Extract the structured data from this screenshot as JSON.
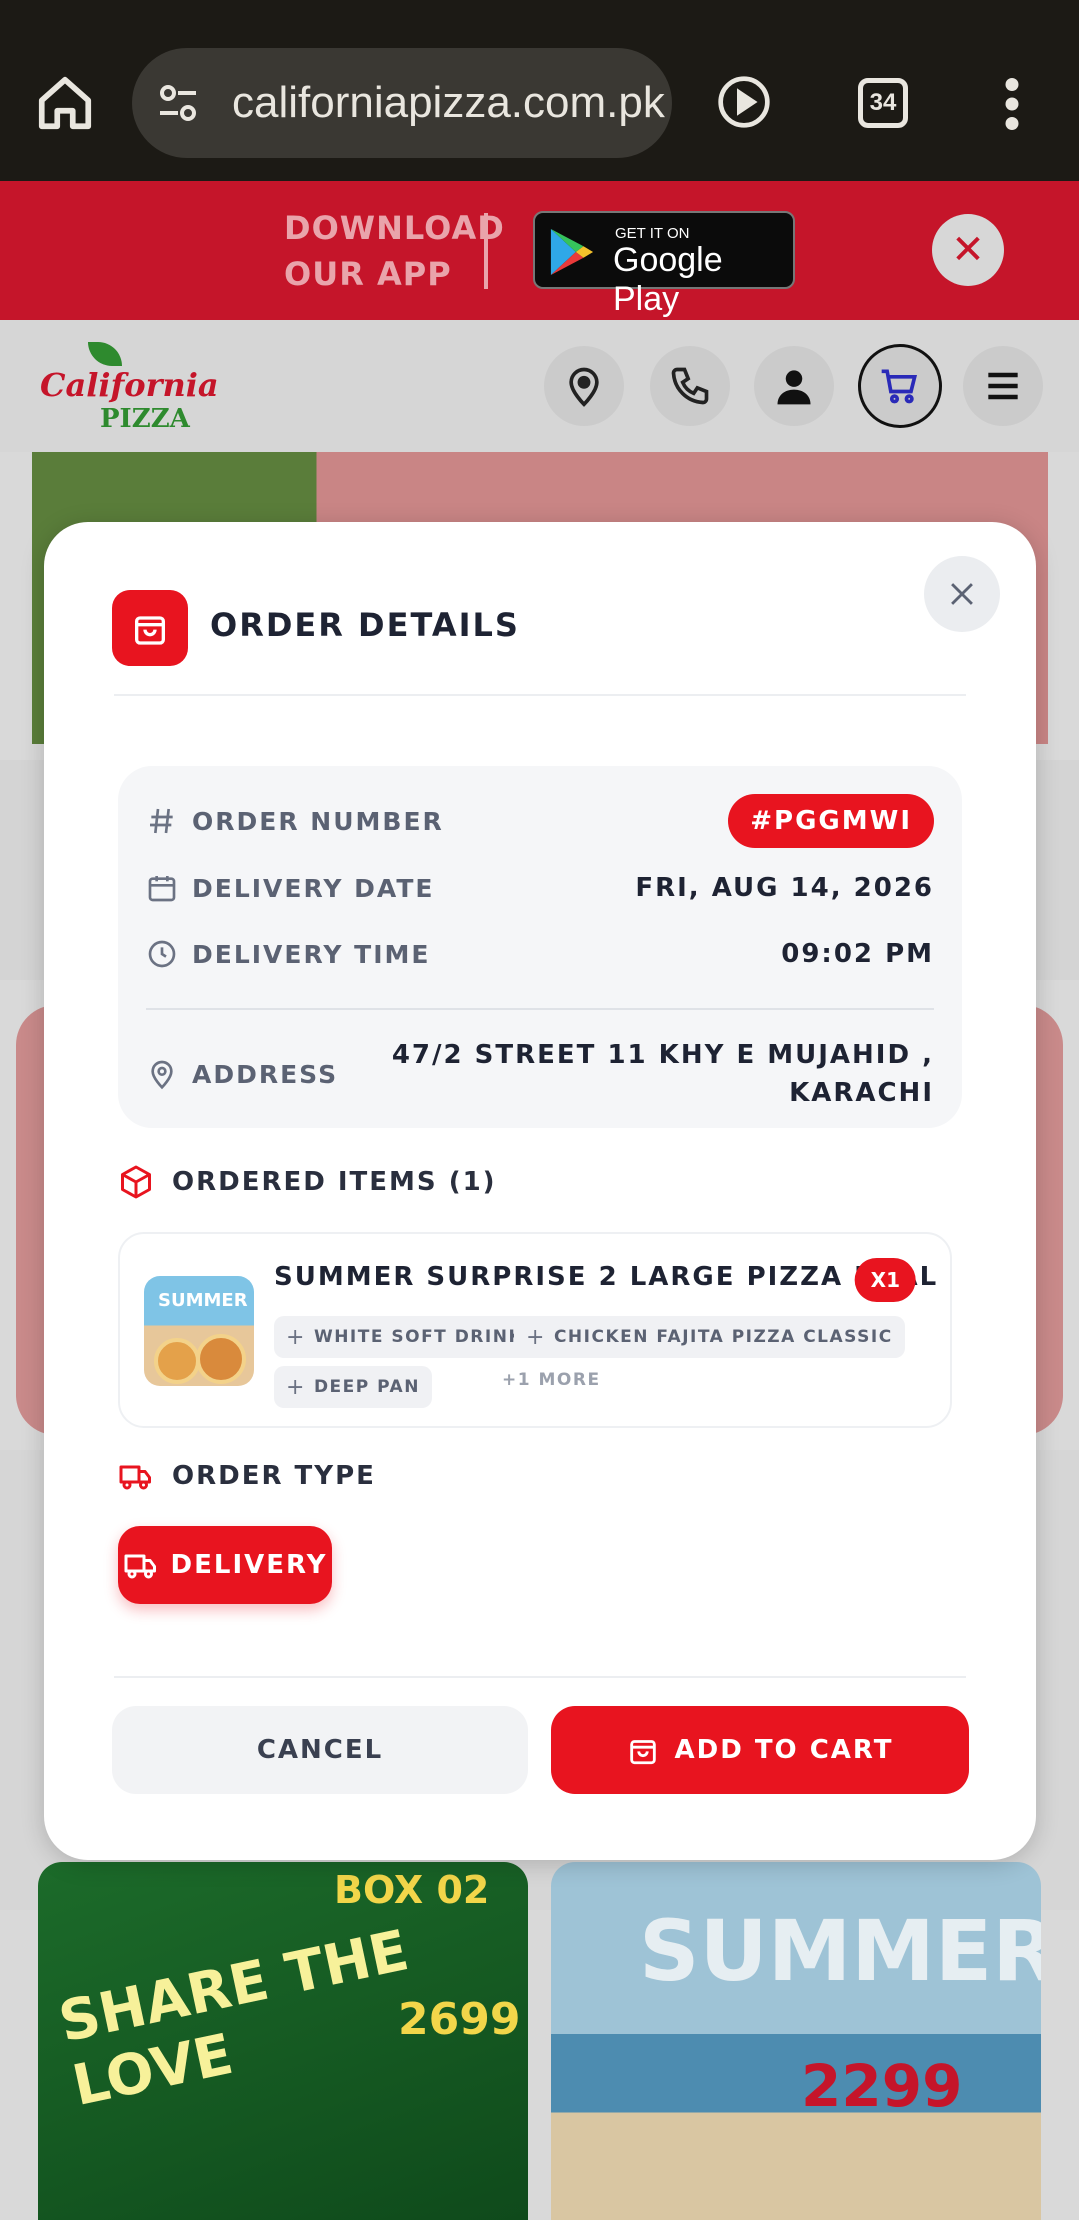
{
  "browser": {
    "url": "californiapizza.com.pk",
    "tab_count": "34"
  },
  "app_banner": {
    "download_line1": "DOWNLOAD",
    "download_line2": "OUR APP",
    "store_small": "GET IT ON",
    "store_big": "Google Play"
  },
  "site": {
    "logo_top": "California",
    "logo_bottom": "PIZZA"
  },
  "background": {
    "promo1_a": "SHARE THE LOVE",
    "promo1_b": "BOX 02",
    "promo1_c": "2699",
    "promo2_a": "SUMMER",
    "promo2_b": "2299"
  },
  "modal": {
    "title": "ORDER DETAILS",
    "order_number_label": "ORDER NUMBER",
    "order_number": "#PGGMWI",
    "delivery_date_label": "DELIVERY DATE",
    "delivery_date": "FRI, AUG 14, 2026",
    "delivery_time_label": "DELIVERY TIME",
    "delivery_time": "09:02 PM",
    "address_label": "ADDRESS",
    "address_line1": "47/2 STREET 11 KHY E MUJAHID ,",
    "address_line2": "KARACHI",
    "ordered_items_label": "ORDERED ITEMS (1)",
    "item": {
      "name": "SUMMER SURPRISE 2 LARGE PIZZA DEAL",
      "qty": "X1",
      "thumb_text": "SUMMER",
      "options": [
        "WHITE SOFT DRINK",
        "CHICKEN FAJITA PIZZA CLASSIC",
        "DEEP PAN"
      ],
      "more": "+1 MORE"
    },
    "order_type_label": "ORDER TYPE",
    "order_type": "DELIVERY",
    "cancel_label": "CANCEL",
    "add_to_cart_label": "ADD TO CART"
  },
  "colors": {
    "accent": "#e8141f",
    "banner": "#c5152a",
    "text_dark": "#1e2333"
  }
}
